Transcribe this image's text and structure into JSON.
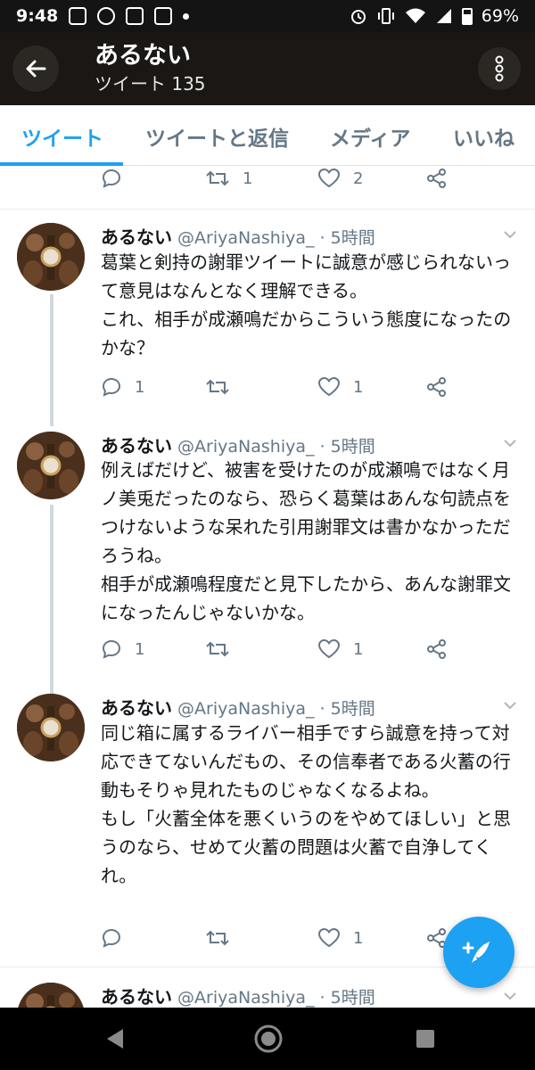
{
  "status_bar": {
    "time": "9:48",
    "battery": "69%"
  },
  "header": {
    "name": "あるない",
    "tweet_count": "ツイート 135"
  },
  "tabs": [
    {
      "label": "ツイート",
      "active": true
    },
    {
      "label": "ツイートと返信",
      "active": false
    },
    {
      "label": "メディア",
      "active": false
    },
    {
      "label": "いいね",
      "active": false
    }
  ],
  "top_actions": {
    "reply": "",
    "retweet": "1",
    "like": "2"
  },
  "tweets": [
    {
      "name": "あるない",
      "meta": "@AriyaNashiya_ · 5時間",
      "text": "葛葉と剣持の謝罪ツイートに誠意が感じられないって意見はなんとなく理解できる。\nこれ、相手が成瀬鳴だからこういう態度になったのかな？",
      "reply": "1",
      "retweet": "",
      "like": "1"
    },
    {
      "name": "あるない",
      "meta": "@AriyaNashiya_ · 5時間",
      "text": "例えばだけど、被害を受けたのが成瀬鳴ではなく月ノ美兎だったのなら、恐らく葛葉はあんな句読点をつけないような呆れた引用謝罪文は書かなかっただろうね。\n相手が成瀬鳴程度だと見下したから、あんな謝罪文になったんじゃないかな。",
      "reply": "1",
      "retweet": "",
      "like": "1"
    },
    {
      "name": "あるない",
      "meta": "@AriyaNashiya_ · 5時間",
      "text": "同じ箱に属するライバー相手ですら誠意を持って対応できてないんだもの、その信奉者である火蓄の行動もそりゃ見れたものじゃなくなるよね。\nもし「火蓄全体を悪くいうのをやめてほしい」と思うのなら、せめて火蓄の問題は火蓄で自浄してくれ。",
      "reply": "",
      "retweet": "",
      "like": "1"
    },
    {
      "name": "あるない",
      "meta": "@AriyaNashiya_ · 5時間"
    }
  ],
  "colors": {
    "accent": "#1da1f2",
    "header_bg": "#1a1714",
    "muted": "#657786"
  },
  "icons": [
    "back-arrow-icon",
    "more-vertical-icon",
    "reply-icon",
    "retweet-icon",
    "like-icon",
    "share-icon",
    "compose-icon",
    "caret-down-icon",
    "nav-back-icon",
    "nav-home-icon",
    "nav-recents-icon"
  ]
}
